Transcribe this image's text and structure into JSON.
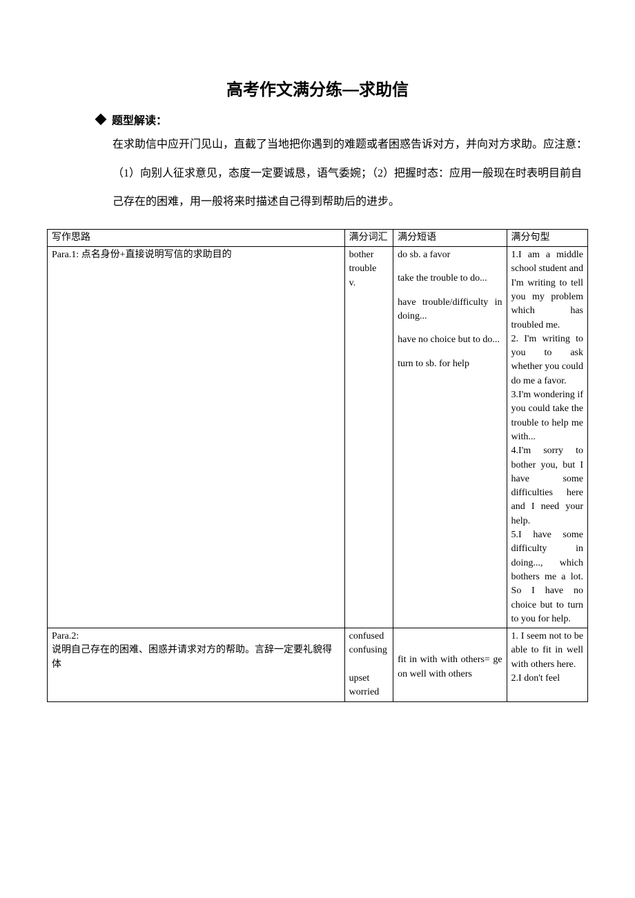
{
  "title": "高考作文满分练—求助信",
  "section_label": "题型解读：",
  "intro": "在求助信中应开门见山，直截了当地把你遇到的难题或者困惑告诉对方，并向对方求助。应注意：（1）向别人征求意见，态度一定要诚恳，语气委婉；（2）把握时态：应用一般现在时表明目前自己存在的困难，用一般将来时描述自己得到帮助后的进步。",
  "headers": {
    "col1": "写作思路",
    "col2": "满分词汇",
    "col3": "满分短语",
    "col4": "满分句型"
  },
  "rows": [
    {
      "idea": "Para.1: 点名身份+直接说明写信的求助目的",
      "vocab": "bother\ntrouble\nv.",
      "phrases": [
        "do sb. a favor",
        "take the trouble to do...",
        "have trouble/difficulty in doing...",
        "have no choice but to do...",
        "turn to sb. for help"
      ],
      "sentences": "1.I am a middle school student and I'm writing to tell you my problem which has troubled me.\n2. I'm writing to you to ask whether you could do me a favor.\n3.I'm wondering if you could take the trouble to help me with...\n4.I'm sorry to bother you, but I have some difficulties here and I need your help.\n5.I have some difficulty in doing..., which bothers me a lot. So I have no choice but to turn to you for help."
    },
    {
      "idea": "Para.2:\n说明自己存在的困难、困惑并请求对方的帮助。言辞一定要礼貌得体",
      "vocab": "confused\nconfusing\n \nupset\nworried",
      "phrases": [
        "",
        "fit in with with others= ge on well with others"
      ],
      "sentences": "1. I seem not to be able to fit in well with others here.\n2.I don't feel"
    }
  ]
}
